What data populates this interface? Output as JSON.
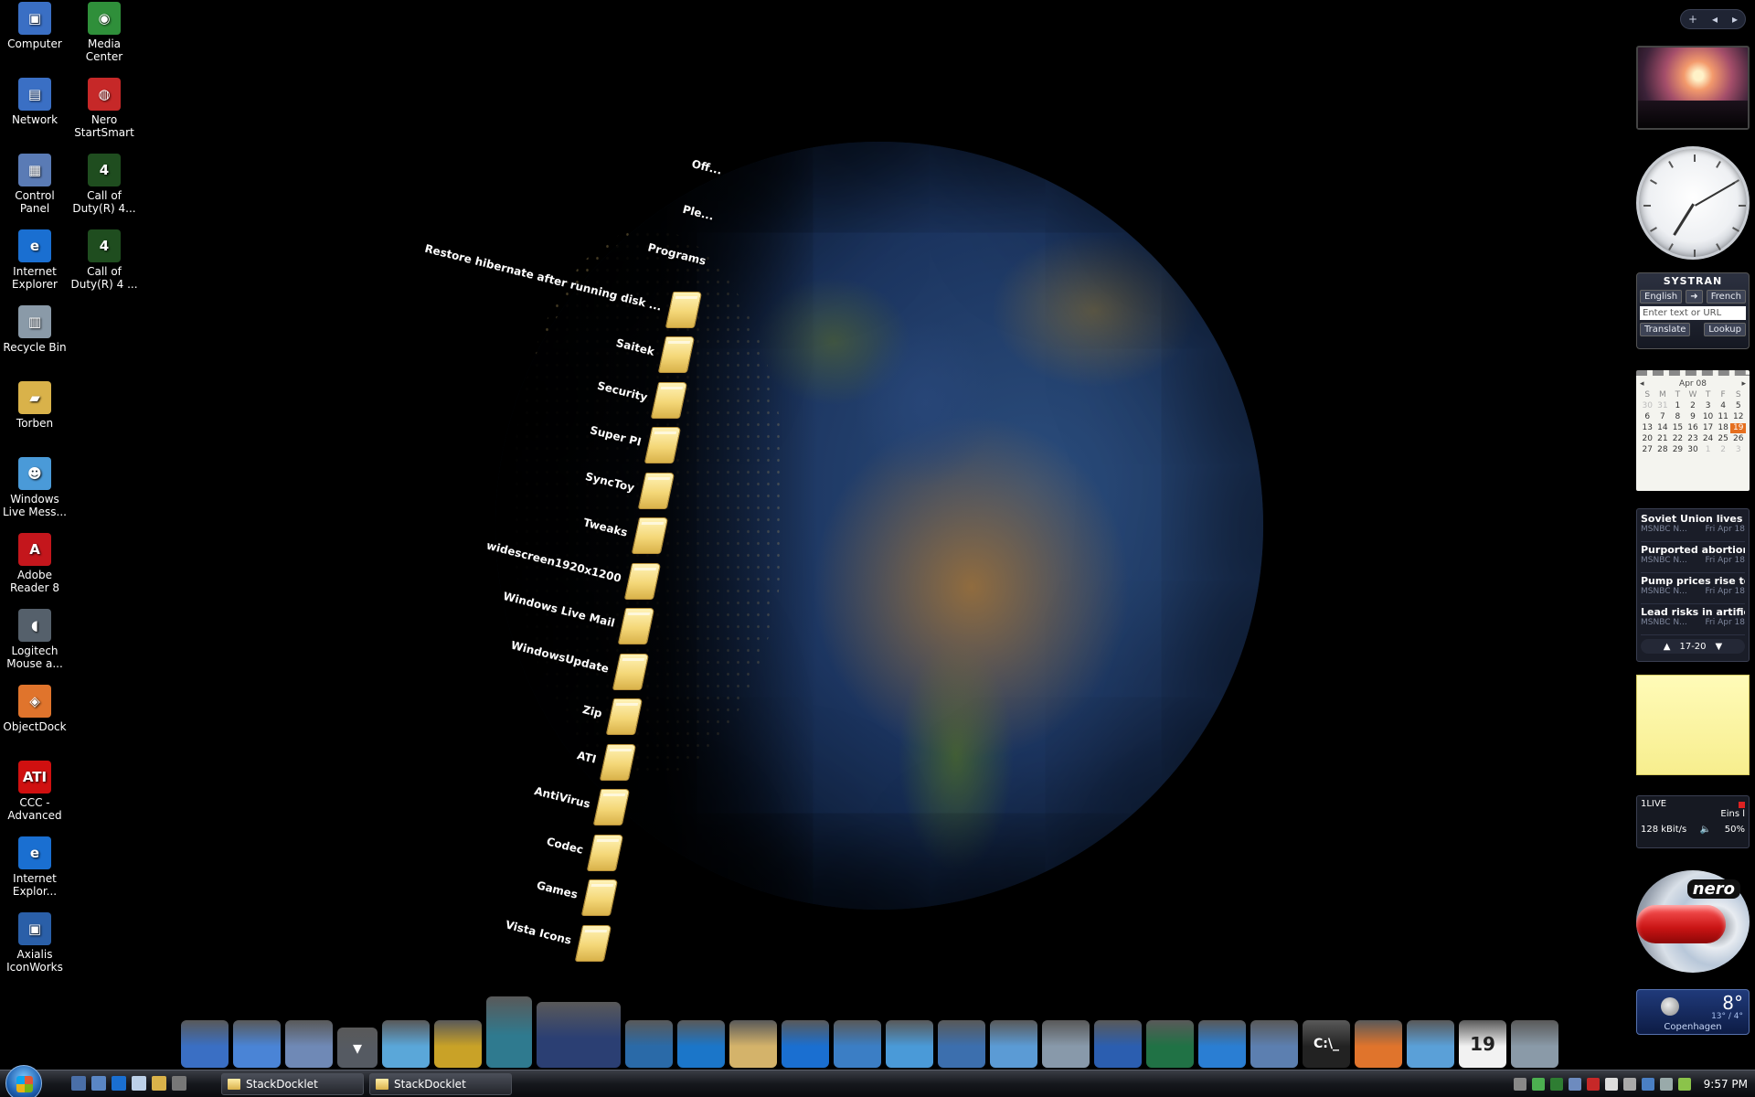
{
  "desktop_icons": [
    {
      "label": "Computer",
      "x": 0,
      "y": 0,
      "color": "#3a6fc4",
      "glyph": "▣"
    },
    {
      "label": "Media Center",
      "x": 1,
      "y": 0,
      "color": "#2f8f3a",
      "glyph": "◉"
    },
    {
      "label": "Network",
      "x": 0,
      "y": 1,
      "color": "#3a6fc4",
      "glyph": "▤"
    },
    {
      "label": "Nero StartSmart",
      "x": 1,
      "y": 1,
      "color": "#c62828",
      "glyph": "◍"
    },
    {
      "label": "Control Panel",
      "x": 0,
      "y": 2,
      "color": "#5a7bb5",
      "glyph": "▦"
    },
    {
      "label": "Call of Duty(R) 4...",
      "x": 1,
      "y": 2,
      "color": "#1f4d1f",
      "glyph": "4"
    },
    {
      "label": "Internet Explorer",
      "x": 0,
      "y": 3,
      "color": "#1a6fd1",
      "glyph": "e"
    },
    {
      "label": "Call of Duty(R) 4 ...",
      "x": 1,
      "y": 3,
      "color": "#1f4d1f",
      "glyph": "4"
    },
    {
      "label": "Recycle Bin",
      "x": 0,
      "y": 4,
      "color": "#8a9aa8",
      "glyph": "▥"
    },
    {
      "label": "Torben",
      "x": 0,
      "y": 5,
      "color": "#d9b24a",
      "glyph": "▰"
    },
    {
      "label": "Windows Live Mess...",
      "x": 0,
      "y": 6,
      "color": "#4a9ad8",
      "glyph": "☻"
    },
    {
      "label": "Adobe Reader 8",
      "x": 0,
      "y": 7,
      "color": "#c4161c",
      "glyph": "A"
    },
    {
      "label": "Logitech Mouse a...",
      "x": 0,
      "y": 8,
      "color": "#55606b",
      "glyph": "◖"
    },
    {
      "label": "ObjectDock",
      "x": 0,
      "y": 9,
      "color": "#e0742c",
      "glyph": "◈"
    },
    {
      "label": "CCC - Advanced",
      "x": 0,
      "y": 10,
      "color": "#d01010",
      "glyph": "ATI"
    },
    {
      "label": "Internet Explor...",
      "x": 0,
      "y": 11,
      "color": "#1a6fd1",
      "glyph": "e"
    },
    {
      "label": "Axialis IconWorks",
      "x": 0,
      "y": 12,
      "color": "#2a5fa8",
      "glyph": "▣"
    }
  ],
  "stack_items": [
    {
      "label": "Off..."
    },
    {
      "label": "Ple..."
    },
    {
      "label": "Programs"
    },
    {
      "label": "Restore hibernate after running disk ..."
    },
    {
      "label": "Saitek"
    },
    {
      "label": "Security"
    },
    {
      "label": "Super PI"
    },
    {
      "label": "SyncToy"
    },
    {
      "label": "Tweaks"
    },
    {
      "label": "widescreen1920x1200"
    },
    {
      "label": "Windows Live Mail"
    },
    {
      "label": "WindowsUpdate"
    },
    {
      "label": "Zip"
    },
    {
      "label": "ATI"
    },
    {
      "label": "AntiVirus"
    },
    {
      "label": "Codec"
    },
    {
      "label": "Games"
    },
    {
      "label": "Vista Icons"
    }
  ],
  "sidebar_top": {
    "add": "+",
    "prev": "◂",
    "next": "▸"
  },
  "systran": {
    "title": "SYSTRAN",
    "from_lang": "English",
    "arrow": "➜",
    "to_lang": "French",
    "input_placeholder": "Enter text or URL",
    "translate": "Translate",
    "lookup": "Lookup"
  },
  "calendar": {
    "month": "Apr 08",
    "prev": "◂",
    "next": "▸",
    "weekdays": [
      "S",
      "M",
      "T",
      "W",
      "T",
      "F",
      "S"
    ],
    "days": [
      {
        "d": "30",
        "dim": true
      },
      {
        "d": "31",
        "dim": true
      },
      {
        "d": "1"
      },
      {
        "d": "2"
      },
      {
        "d": "3"
      },
      {
        "d": "4"
      },
      {
        "d": "5"
      },
      {
        "d": "6"
      },
      {
        "d": "7"
      },
      {
        "d": "8"
      },
      {
        "d": "9"
      },
      {
        "d": "10"
      },
      {
        "d": "11"
      },
      {
        "d": "12"
      },
      {
        "d": "13"
      },
      {
        "d": "14"
      },
      {
        "d": "15"
      },
      {
        "d": "16"
      },
      {
        "d": "17"
      },
      {
        "d": "18"
      },
      {
        "d": "19",
        "today": true
      },
      {
        "d": "20"
      },
      {
        "d": "21"
      },
      {
        "d": "22"
      },
      {
        "d": "23"
      },
      {
        "d": "24"
      },
      {
        "d": "25"
      },
      {
        "d": "26"
      },
      {
        "d": "27"
      },
      {
        "d": "28"
      },
      {
        "d": "29"
      },
      {
        "d": "30"
      },
      {
        "d": "1",
        "dim": true
      },
      {
        "d": "2",
        "dim": true
      },
      {
        "d": "3",
        "dim": true
      }
    ]
  },
  "news": {
    "items": [
      {
        "title": "Soviet Union lives on...",
        "source": "MSNBC N...",
        "date": "Fri Apr 18"
      },
      {
        "title": "Purported abortion a...",
        "source": "MSNBC N...",
        "date": "Fri Apr 18"
      },
      {
        "title": "Pump prices rise to n...",
        "source": "MSNBC N...",
        "date": "Fri Apr 18"
      },
      {
        "title": "Lead risks in artificia...",
        "source": "MSNBC N...",
        "date": "Fri Apr 18"
      }
    ],
    "pager": "17-20"
  },
  "radio": {
    "station": "1LIVE",
    "now_playing": "Eins l",
    "bitrate": "128 kBit/s",
    "volume": "50%"
  },
  "nero": {
    "logo": "nero"
  },
  "weather": {
    "temp": "8°",
    "range": "13° / 4°",
    "city": "Copenhagen"
  },
  "dock_items": [
    {
      "name": "computer",
      "color": "#3a6fc4"
    },
    {
      "name": "network",
      "color": "#4a84d6"
    },
    {
      "name": "control-panel",
      "color": "#6f89b6"
    },
    {
      "name": "dropdown",
      "color": "#555a62"
    },
    {
      "name": "documents",
      "color": "#5aa7d9"
    },
    {
      "name": "security",
      "color": "#c9a227"
    },
    {
      "name": "windows-dvd",
      "color": "#2f7a8f"
    },
    {
      "name": "astronaut",
      "color": "#2b3f73"
    },
    {
      "name": "media-player",
      "color": "#2a6aa8"
    },
    {
      "name": "media-center",
      "color": "#1b76c9"
    },
    {
      "name": "library",
      "color": "#d4b36a"
    },
    {
      "name": "internet-explorer",
      "color": "#1a6fd1"
    },
    {
      "name": "mail",
      "color": "#3b7ec5"
    },
    {
      "name": "messenger",
      "color": "#4a9ad8"
    },
    {
      "name": "calendar",
      "color": "#3c6fae"
    },
    {
      "name": "contacts",
      "color": "#5b9bd5"
    },
    {
      "name": "calculator",
      "color": "#8899aa"
    },
    {
      "name": "word",
      "color": "#2b5eb0"
    },
    {
      "name": "excel",
      "color": "#207245"
    },
    {
      "name": "feather",
      "color": "#2a7ed3"
    },
    {
      "name": "screen",
      "color": "#5c7fb0"
    },
    {
      "name": "command-prompt",
      "color": "#222222"
    },
    {
      "name": "windows",
      "color": "#e0742c"
    },
    {
      "name": "settings",
      "color": "#5aa0d8"
    },
    {
      "name": "calendar-19",
      "color": "#f2f2f2"
    },
    {
      "name": "recycle-bin",
      "color": "#8a9aa8"
    }
  ],
  "dock_calendar_day": "19",
  "dock_cmd_label": "C:\\_",
  "taskbar": {
    "buttons": [
      "StackDocklet",
      "StackDocklet"
    ],
    "time": "9:57 PM"
  }
}
